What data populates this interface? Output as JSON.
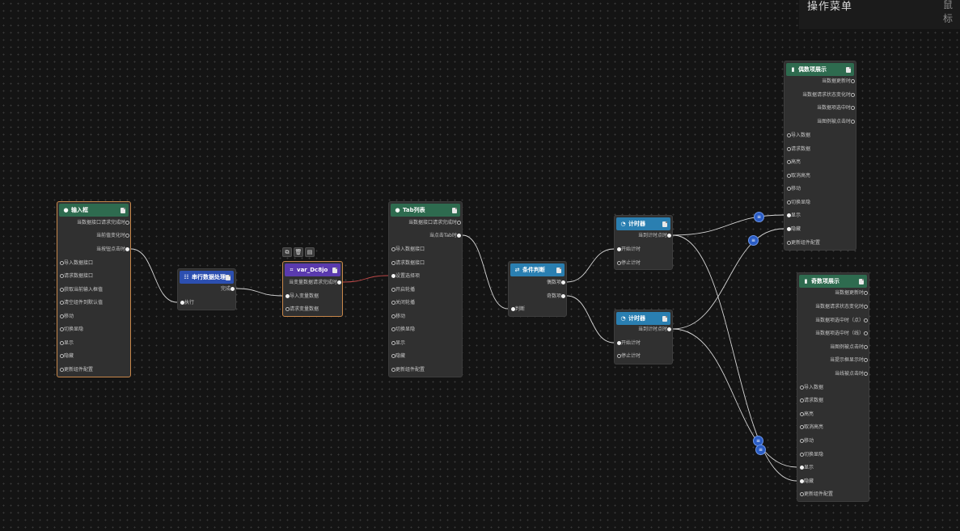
{
  "menu": {
    "title": "操作菜单",
    "side": "鼠标"
  },
  "toolbar": {
    "items": [
      {
        "icon": "copy-icon",
        "glyph": "⧉"
      },
      {
        "icon": "delete-icon",
        "glyph": "🗑"
      },
      {
        "icon": "trash-icon",
        "glyph": "▤"
      }
    ]
  },
  "colors": {
    "green": "#2e6b4f",
    "blue": "#2c4fb0",
    "purple": "#5a3aae",
    "cyan": "#2a7fb1",
    "selected": "#c8874a",
    "wire": "#d6d6d6",
    "wire_red": "#c04a4a"
  },
  "nodes": {
    "input": {
      "title": "输入框",
      "icon": "circle-icon",
      "glyph": "●",
      "outputs": [
        "当数据接口请求完成时",
        "当前值变化时",
        "当按钮点击时"
      ],
      "inputs": [
        "导入数据接口",
        "请求数据接口",
        "获取当前输入框值",
        "清空组件到默认值",
        "移动",
        "切换显隐",
        "显示",
        "隐藏",
        "更新组件配置"
      ]
    },
    "serial": {
      "title": "串行数据处理",
      "icon": "serial-icon",
      "glyph": "☷",
      "outputs": [
        "完成"
      ],
      "inputs": [
        "执行"
      ]
    },
    "var": {
      "title": "var_Dc8jo",
      "icon": "variable-icon",
      "glyph": "⌗",
      "outputs": [
        "当变量数据请求完成时"
      ],
      "inputs": [
        "导入变量数据",
        "请求变量数据"
      ]
    },
    "tab": {
      "title": "Tab列表",
      "icon": "tab-icon",
      "glyph": "●",
      "outputs": [
        "当数据接口请求完成时",
        "当点击Tab时"
      ],
      "inputs": [
        "导入数据接口",
        "请求数据接口",
        "设置选择项",
        "开启轮播",
        "关闭轮播",
        "移动",
        "切换显隐",
        "显示",
        "隐藏",
        "更新组件配置"
      ]
    },
    "cond": {
      "title": "条件判断",
      "icon": "condition-icon",
      "glyph": "⇄",
      "outputs": [
        "偶数项",
        "奇数项"
      ],
      "inputs": [
        "判断"
      ]
    },
    "timer1": {
      "title": "计时器",
      "icon": "clock-icon",
      "glyph": "◔",
      "outputs": [
        "当到计时点时"
      ],
      "inputs": [
        "开始计时",
        "停止计时"
      ]
    },
    "timer2": {
      "title": "计时器",
      "icon": "clock-icon",
      "glyph": "◔",
      "outputs": [
        "当到计时点时"
      ],
      "inputs": [
        "开始计时",
        "停止计时"
      ]
    },
    "even": {
      "title": "偶数项展示",
      "icon": "chart-icon",
      "glyph": "▮",
      "outputs": [
        "当数据更新时",
        "当数据请求状态变化时",
        "当数据项选中时",
        "当图例被点击时"
      ],
      "inputs": [
        "导入数据",
        "请求数据",
        "高亮",
        "取消高亮",
        "移动",
        "切换显隐",
        "显示",
        "隐藏",
        "更新组件配置"
      ]
    },
    "odd": {
      "title": "奇数项展示",
      "icon": "chart-icon",
      "glyph": "▮",
      "outputs": [
        "当数据更新时",
        "当数据请求状态变化时",
        "当数据项选中时（点）",
        "当数据项选中时（线）",
        "当图例被点击时",
        "当提示框显示时",
        "当线被点击时"
      ],
      "inputs": [
        "导入数据",
        "请求数据",
        "高亮",
        "取消高亮",
        "移动",
        "切换显隐",
        "显示",
        "隐藏",
        "更新组件配置"
      ]
    }
  }
}
